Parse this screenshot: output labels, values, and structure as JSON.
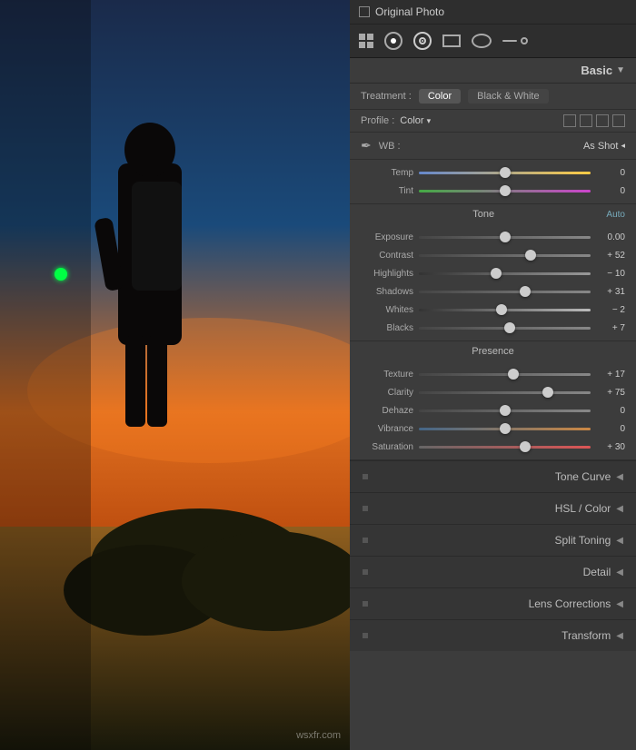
{
  "topBar": {
    "checkboxLabel": "Original Photo"
  },
  "tools": {
    "icons": [
      "grid",
      "circle-dot",
      "radio",
      "rect",
      "oval",
      "slider"
    ]
  },
  "basic": {
    "title": "Basic",
    "treatment": {
      "label": "Treatment :",
      "colorBtn": "Color",
      "bwBtn": "Black & White"
    },
    "profile": {
      "label": "Profile :",
      "value": "Color",
      "dropdown": "▾"
    },
    "wb": {
      "label": "WB :",
      "value": "As Shot",
      "dropdown": "◂"
    },
    "sliders": {
      "temp": {
        "label": "Temp",
        "value": "0",
        "thumbPct": 50
      },
      "tint": {
        "label": "Tint",
        "value": "0",
        "thumbPct": 50
      }
    },
    "tone": {
      "sectionLabel": "Tone",
      "autoLabel": "Auto",
      "exposure": {
        "label": "Exposure",
        "value": "0.00",
        "thumbPct": 50
      },
      "contrast": {
        "label": "Contrast",
        "value": "+ 52",
        "thumbPct": 65
      },
      "highlights": {
        "label": "Highlights",
        "value": "− 10",
        "thumbPct": 45
      },
      "shadows": {
        "label": "Shadows",
        "value": "+ 31",
        "thumbPct": 62
      },
      "whites": {
        "label": "Whites",
        "value": "− 2",
        "thumbPct": 48
      },
      "blacks": {
        "label": "Blacks",
        "value": "+ 7",
        "thumbPct": 53
      }
    },
    "presence": {
      "sectionLabel": "Presence",
      "texture": {
        "label": "Texture",
        "value": "+ 17",
        "thumbPct": 55
      },
      "clarity": {
        "label": "Clarity",
        "value": "+ 75",
        "thumbPct": 75
      },
      "dehaze": {
        "label": "Dehaze",
        "value": "0",
        "thumbPct": 50
      },
      "vibrance": {
        "label": "Vibrance",
        "value": "0",
        "thumbPct": 50
      },
      "saturation": {
        "label": "Saturation",
        "value": "+ 30",
        "thumbPct": 62
      }
    }
  },
  "collapsedPanels": [
    {
      "label": "Tone Curve"
    },
    {
      "label": "HSL / Color"
    },
    {
      "label": "Split Toning"
    },
    {
      "label": "Detail"
    },
    {
      "label": "Lens Corrections"
    },
    {
      "label": "Transform"
    }
  ],
  "watermark": "wsxfr.com"
}
